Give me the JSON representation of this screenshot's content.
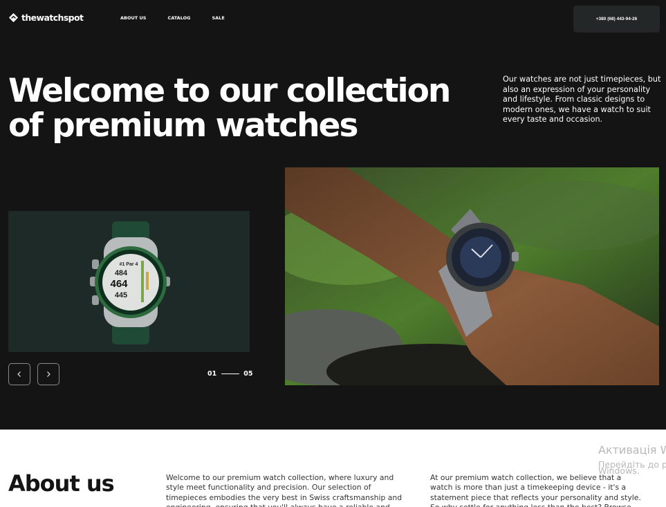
{
  "brand": {
    "name": "thewatchspot"
  },
  "nav": {
    "items": [
      "ABOUT US",
      "CATALOG",
      "SALE"
    ]
  },
  "header": {
    "phone": "+380 (68) 443-94-26"
  },
  "hero": {
    "headline": "Welcome to our collection of premium watches",
    "intro": "Our watches are not just timepieces, but also an expression of your personality and lifestyle. From classic designs to modern ones, we have a watch to suit every taste and occasion.",
    "slider": {
      "current": "01",
      "total": "05"
    },
    "small_watch_display": {
      "line1": "#1 Par 4",
      "line2": "484",
      "line3": "464",
      "line4": "445"
    }
  },
  "about": {
    "title": "About us",
    "col1": "Welcome to our premium watch collection, where luxury and style meet functionality and precision. Our selection of timepieces embodies the very best in Swiss craftsmanship and engineering, ensuring that you'll always have a reliable and stylish accessory on",
    "col2": "At our premium watch collection, we believe that a watch is more than just a timekeeping device - it's a statement piece that reflects your personality and style. So why settle for anything less than the best? Browse our"
  },
  "overlay": {
    "activation_title": "Активація W",
    "activation_sub": "Перейдіть до р",
    "activation_sub2": "Windows."
  },
  "colors": {
    "background": "#141414",
    "card": "#1d2a27",
    "accent_button": "#232727"
  },
  "icons": [
    "logo-mark-icon",
    "chevron-left-icon",
    "chevron-right-icon"
  ]
}
